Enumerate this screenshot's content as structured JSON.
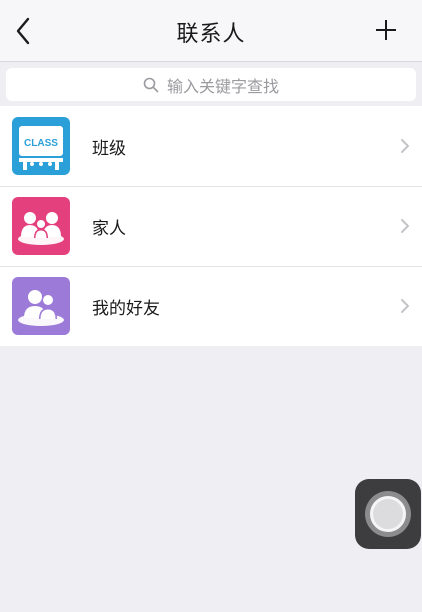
{
  "nav": {
    "title": "联系人",
    "back_icon": "chevron-left-icon",
    "add_icon": "plus-icon"
  },
  "search": {
    "placeholder": "输入关键字查找",
    "icon": "search-icon"
  },
  "contacts": [
    {
      "label": "班级",
      "icon": "class-board-icon",
      "icon_text": "CLASS",
      "color": "#2a9fd8"
    },
    {
      "label": "家人",
      "icon": "family-icon",
      "color": "#e4407e"
    },
    {
      "label": "我的好友",
      "icon": "friends-icon",
      "color": "#9b7ad8"
    }
  ],
  "colors": {
    "background": "#eeeef3",
    "nav_background": "#f7f7f9",
    "chevron": "#c4c4c8"
  }
}
